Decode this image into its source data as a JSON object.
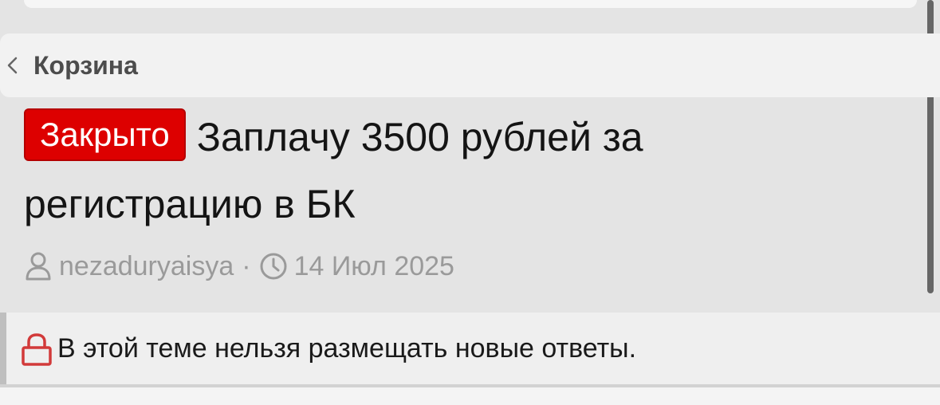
{
  "breadcrumb": {
    "label": "Корзина",
    "icon": "chevron-left-icon"
  },
  "thread": {
    "status_badge": "Закрыто",
    "title": "Заплачу 3500 рублей за регистрацию в БК",
    "author": "nezaduryaisya",
    "separator": "·",
    "date": "14 Июл 2025"
  },
  "notice": {
    "text": "В этой теме нельзя размещать новые ответы.",
    "icon": "lock-icon"
  },
  "colors": {
    "badge_bg": "#dd0000",
    "lock": "#d23a3a",
    "meta_text": "#9a9a9a"
  }
}
